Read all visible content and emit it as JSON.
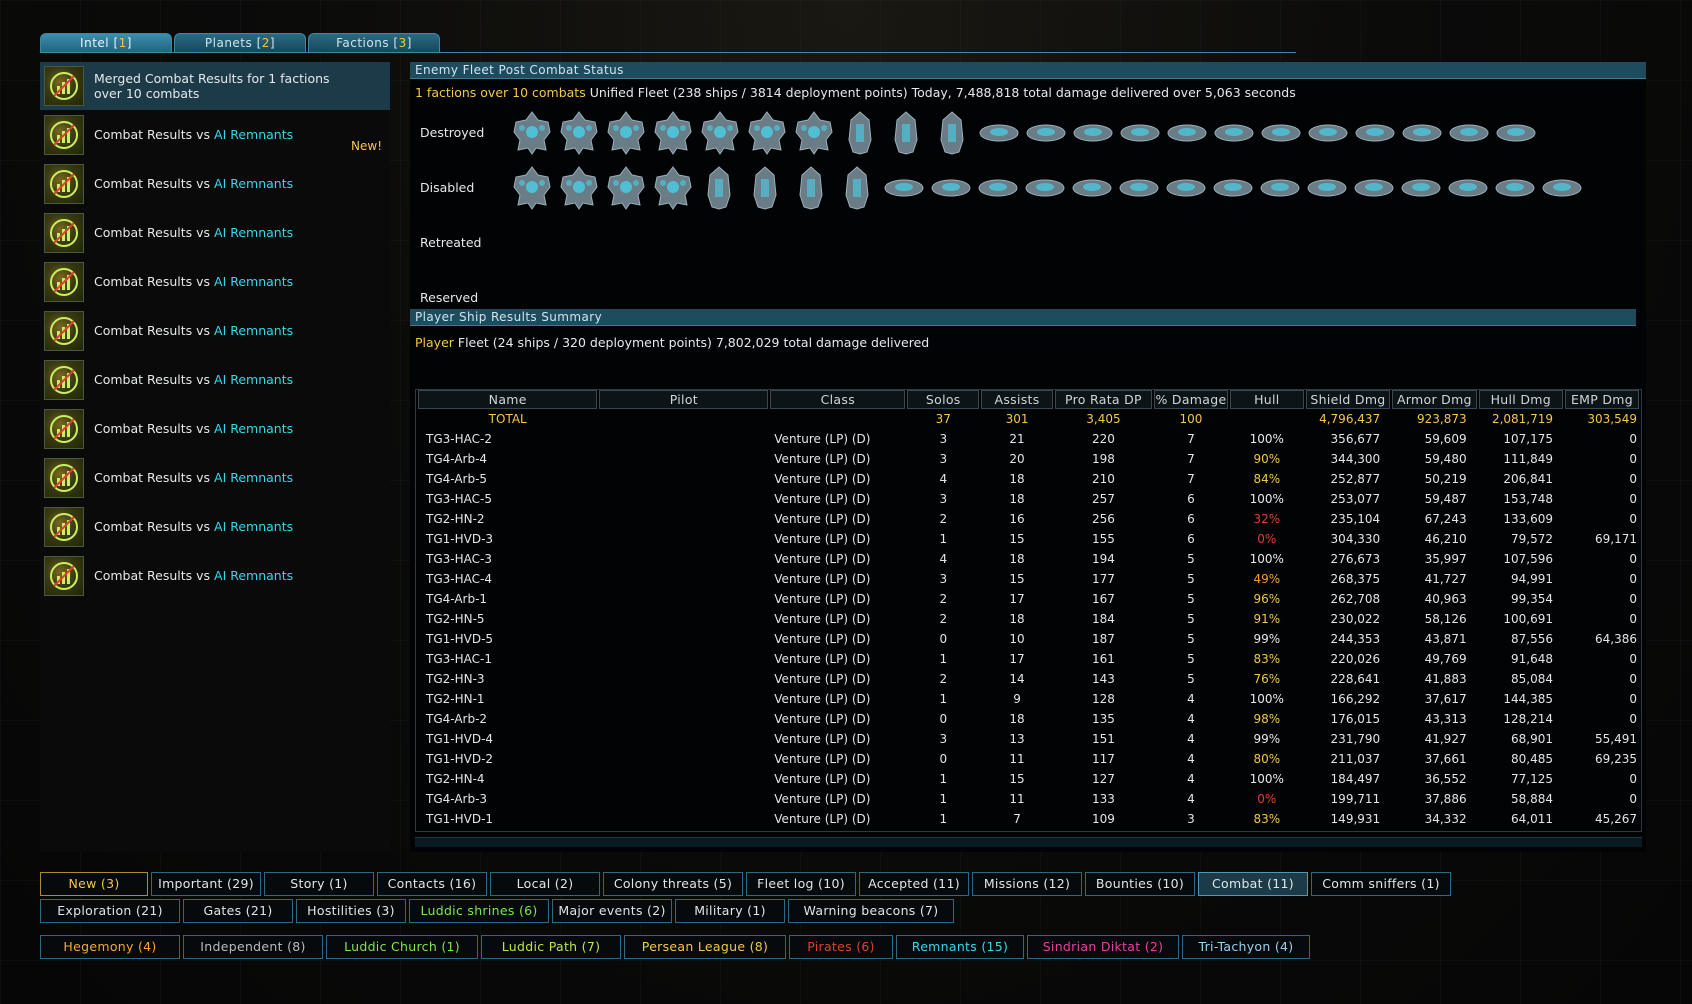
{
  "tabs": [
    {
      "label": "Intel",
      "count": "1"
    },
    {
      "label": "Planets",
      "count": "2"
    },
    {
      "label": "Factions",
      "count": "3"
    }
  ],
  "intel_list": {
    "first": {
      "line1": "Merged Combat Results for 1 factions",
      "line2": "over 10 combats"
    },
    "item_prefix": "Combat Results vs ",
    "item_faction": "AI Remnants",
    "new_badge": "New!"
  },
  "enemy_section": {
    "header": "Enemy Fleet Post Combat Status",
    "summary_highlight": "1 factions over 10 combats",
    "summary_rest": " Unified Fleet (238 ships / 3814 deployment points) Today, 7,488,818 total damage delivered over 5,063 seconds",
    "rows": [
      {
        "label": "Destroyed",
        "ships": [
          "cruiser",
          "cruiser",
          "cruiser",
          "cruiser",
          "cruiser",
          "cruiser",
          "cruiser",
          "frigate",
          "frigate",
          "frigate",
          "drone",
          "drone",
          "drone",
          "drone",
          "drone",
          "drone",
          "drone",
          "drone",
          "drone",
          "drone",
          "drone",
          "drone"
        ]
      },
      {
        "label": "Disabled",
        "ships": [
          "cruiser",
          "cruiser",
          "cruiser",
          "cruiser",
          "frigate",
          "frigate",
          "frigate",
          "frigate",
          "drone",
          "drone",
          "drone",
          "drone",
          "drone",
          "drone",
          "drone",
          "drone",
          "drone",
          "drone",
          "drone",
          "drone",
          "drone",
          "drone",
          "drone"
        ]
      },
      {
        "label": "Retreated",
        "ships": []
      },
      {
        "label": "Reserved",
        "ships": []
      }
    ]
  },
  "player_section": {
    "header": "Player Ship Results Summary",
    "summary_highlight": "Player",
    "summary_rest": " Fleet (24 ships / 320 deployment points) 7,802,029 total damage delivered",
    "columns": [
      "Name",
      "Pilot",
      "Class",
      "Solos",
      "Assists",
      "Pro Rata DP",
      "% Damage",
      "Hull",
      "Shield Dmg",
      "Armor Dmg",
      "Hull Dmg",
      "EMP Dmg"
    ],
    "total": {
      "name": "TOTAL",
      "solos": "37",
      "assists": "301",
      "dp": "3,405",
      "pct": "100",
      "shield": "4,796,437",
      "armor": "923,873",
      "hulldmg": "2,081,719",
      "emp": "303,549"
    },
    "rows": [
      [
        "TG3-HAC-2",
        "",
        "Venture (LP) (D)",
        "3",
        "21",
        "220",
        "7",
        "100%",
        "356,677",
        "59,609",
        "107,175",
        "0"
      ],
      [
        "TG4-Arb-4",
        "",
        "Venture (LP) (D)",
        "3",
        "20",
        "198",
        "7",
        "90%",
        "344,300",
        "59,480",
        "111,849",
        "0"
      ],
      [
        "TG4-Arb-5",
        "",
        "Venture (LP) (D)",
        "4",
        "18",
        "210",
        "7",
        "84%",
        "252,877",
        "50,219",
        "206,841",
        "0"
      ],
      [
        "TG3-HAC-5",
        "",
        "Venture (LP) (D)",
        "3",
        "18",
        "257",
        "6",
        "100%",
        "253,077",
        "59,487",
        "153,748",
        "0"
      ],
      [
        "TG2-HN-2",
        "",
        "Venture (LP) (D)",
        "2",
        "16",
        "256",
        "6",
        "32%",
        "235,104",
        "67,243",
        "133,609",
        "0"
      ],
      [
        "TG1-HVD-3",
        "",
        "Venture (LP) (D)",
        "1",
        "15",
        "155",
        "6",
        "0%",
        "304,330",
        "46,210",
        "79,572",
        "69,171"
      ],
      [
        "TG3-HAC-3",
        "",
        "Venture (LP) (D)",
        "4",
        "18",
        "194",
        "5",
        "100%",
        "276,673",
        "35,997",
        "107,596",
        "0"
      ],
      [
        "TG3-HAC-4",
        "",
        "Venture (LP) (D)",
        "3",
        "15",
        "177",
        "5",
        "49%",
        "268,375",
        "41,727",
        "94,991",
        "0"
      ],
      [
        "TG4-Arb-1",
        "",
        "Venture (LP) (D)",
        "2",
        "17",
        "167",
        "5",
        "96%",
        "262,708",
        "40,963",
        "99,354",
        "0"
      ],
      [
        "TG2-HN-5",
        "",
        "Venture (LP) (D)",
        "2",
        "18",
        "184",
        "5",
        "91%",
        "230,022",
        "58,126",
        "100,691",
        "0"
      ],
      [
        "TG1-HVD-5",
        "",
        "Venture (LP) (D)",
        "0",
        "10",
        "187",
        "5",
        "99%",
        "244,353",
        "43,871",
        "87,556",
        "64,386"
      ],
      [
        "TG3-HAC-1",
        "",
        "Venture (LP) (D)",
        "1",
        "17",
        "161",
        "5",
        "83%",
        "220,026",
        "49,769",
        "91,648",
        "0"
      ],
      [
        "TG2-HN-3",
        "",
        "Venture (LP) (D)",
        "2",
        "14",
        "143",
        "5",
        "76%",
        "228,641",
        "41,883",
        "85,084",
        "0"
      ],
      [
        "TG2-HN-1",
        "",
        "Venture (LP) (D)",
        "1",
        "9",
        "128",
        "4",
        "100%",
        "166,292",
        "37,617",
        "144,385",
        "0"
      ],
      [
        "TG4-Arb-2",
        "",
        "Venture (LP) (D)",
        "0",
        "18",
        "135",
        "4",
        "98%",
        "176,015",
        "43,313",
        "128,214",
        "0"
      ],
      [
        "TG1-HVD-4",
        "",
        "Venture (LP) (D)",
        "3",
        "13",
        "151",
        "4",
        "99%",
        "231,790",
        "41,927",
        "68,901",
        "55,491"
      ],
      [
        "TG1-HVD-2",
        "",
        "Venture (LP) (D)",
        "0",
        "11",
        "117",
        "4",
        "80%",
        "211,037",
        "37,661",
        "80,485",
        "69,235"
      ],
      [
        "TG2-HN-4",
        "",
        "Venture (LP) (D)",
        "1",
        "15",
        "127",
        "4",
        "100%",
        "184,497",
        "36,552",
        "77,125",
        "0"
      ],
      [
        "TG4-Arb-3",
        "",
        "Venture (LP) (D)",
        "1",
        "11",
        "133",
        "4",
        "0%",
        "199,711",
        "37,886",
        "58,884",
        "0"
      ],
      [
        "TG1-HVD-1",
        "",
        "Venture (LP) (D)",
        "1",
        "7",
        "109",
        "3",
        "83%",
        "149,931",
        "34,332",
        "64,011",
        "45,267"
      ]
    ]
  },
  "filters_row1": [
    {
      "label": "New (3)",
      "color": "#f4c64a",
      "w": 108,
      "state": "on"
    },
    {
      "label": "Important (29)",
      "color": "#e0e5e8",
      "w": 110
    },
    {
      "label": "Story (1)",
      "color": "#e0e5e8",
      "w": 110
    },
    {
      "label": "Contacts (16)",
      "color": "#e0e5e8",
      "w": 110
    },
    {
      "label": "Local (2)",
      "color": "#e0e5e8",
      "w": 110
    },
    {
      "label": "Colony threats (5)",
      "color": "#e0e5e8",
      "w": 140
    },
    {
      "label": "Fleet log (10)",
      "color": "#e0e5e8",
      "w": 110
    },
    {
      "label": "Accepted (11)",
      "color": "#e0e5e8",
      "w": 110
    },
    {
      "label": "Missions (12)",
      "color": "#e0e5e8",
      "w": 110
    },
    {
      "label": "Bounties (10)",
      "color": "#e0e5e8",
      "w": 110
    },
    {
      "label": "Combat (11)",
      "color": "#e0e5e8",
      "w": 110,
      "state": "active"
    },
    {
      "label": "Comm sniffers (1)",
      "color": "#e0e5e8",
      "w": 140
    }
  ],
  "filters_row2": [
    {
      "label": "Exploration (21)",
      "color": "#e0e5e8",
      "w": 140
    },
    {
      "label": "Gates (21)",
      "color": "#e0e5e8",
      "w": 110
    },
    {
      "label": "Hostilities (3)",
      "color": "#e0e5e8",
      "w": 110
    },
    {
      "label": "Luddic shrines (6)",
      "color": "#7de84a",
      "w": 140
    },
    {
      "label": "Major events (2)",
      "color": "#e0e5e8",
      "w": 120
    },
    {
      "label": "Military (1)",
      "color": "#e0e5e8",
      "w": 110
    },
    {
      "label": "Warning beacons (7)",
      "color": "#e0e5e8",
      "w": 166
    }
  ],
  "filters_row3": [
    {
      "label": "Hegemony (4)",
      "color": "#f4a830",
      "w": 140
    },
    {
      "label": "Independent (8)",
      "color": "#b8bcbe",
      "w": 140
    },
    {
      "label": "Luddic Church (1)",
      "color": "#7de84a",
      "w": 152
    },
    {
      "label": "Luddic Path (7)",
      "color": "#b8e840",
      "w": 140
    },
    {
      "label": "Persean League (8)",
      "color": "#f4c64a",
      "w": 162
    },
    {
      "label": "Pirates (6)",
      "color": "#e04030",
      "w": 104
    },
    {
      "label": "Remnants (15)",
      "color": "#35d8e8",
      "w": 128
    },
    {
      "label": "Sindrian Diktat (2)",
      "color": "#e840a0",
      "w": 152
    },
    {
      "label": "Tri-Tachyon (4)",
      "color": "#9ad0f0",
      "w": 128
    }
  ],
  "colors": {
    "accent": "#2b6a82",
    "highlight": "#35d8e8",
    "yellow": "#f4c64a"
  }
}
